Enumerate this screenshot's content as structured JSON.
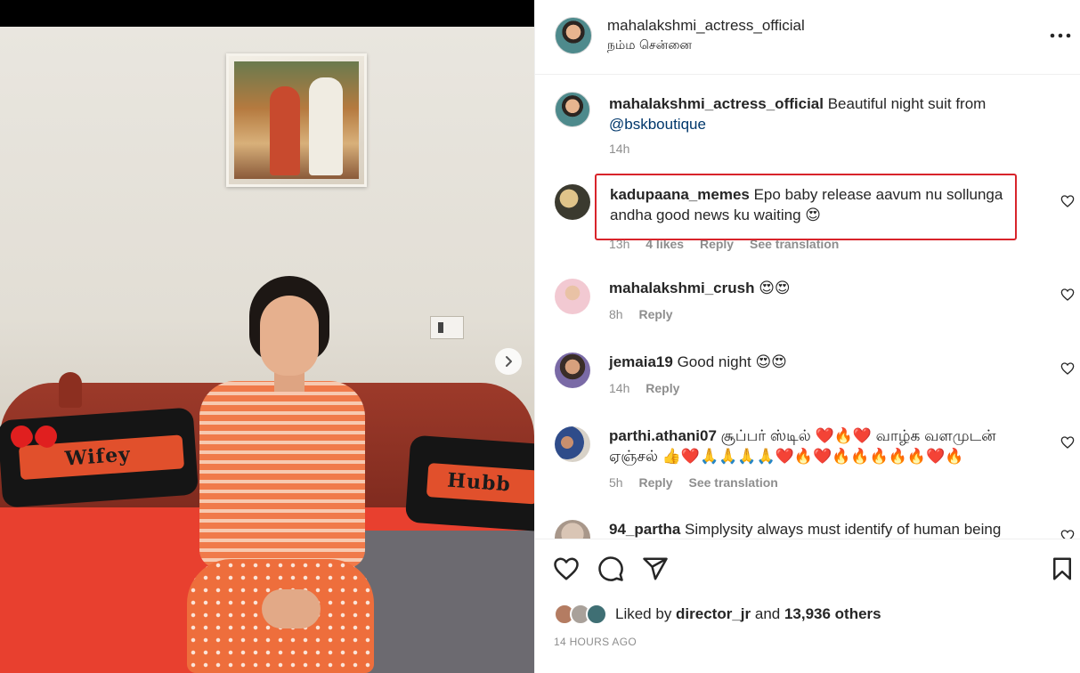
{
  "post": {
    "username": "mahalakshmi_actress_official",
    "location": "நம்ம சென்னை",
    "media": {
      "pillow_left_text": "Wifey",
      "pillow_right_text": "Hubb"
    }
  },
  "caption": {
    "username": "mahalakshmi_actress_official",
    "text": " Beautiful night suit from ",
    "mention": "@bskboutique",
    "time": "14h"
  },
  "comments": [
    {
      "username": "kadupaana_memes",
      "text": " Epo baby release aavum nu sollunga andha good news ku waiting 😍",
      "time": "13h",
      "likes": "4 likes",
      "reply": "Reply",
      "translate": "See translation"
    },
    {
      "username": "mahalakshmi_crush",
      "text": " 😍😍",
      "time": "8h",
      "reply": "Reply"
    },
    {
      "username": "jemaia19",
      "text": " Good night 😍😍",
      "time": "14h",
      "reply": "Reply"
    },
    {
      "username": "parthi.athani07",
      "text": " சூப்பர் ஸ்டில் ❤️🔥❤️ வாழ்க வளமுடன் ஏஞ்சல் 👍❤️🙏🙏🙏🙏❤️🔥❤️🔥🔥🔥🔥🔥❤️🔥",
      "time": "5h",
      "reply": "Reply",
      "translate": "See translation"
    },
    {
      "username": "94_partha",
      "text": " Simplysity always must identify of human being"
    }
  ],
  "likes": {
    "prefix": "Liked by ",
    "user": "director_jr",
    "middle": " and ",
    "count": "13,936 others"
  },
  "time_ago": "14 HOURS AGO",
  "colors": {
    "highlight_border": "#d8242b",
    "link": "#00376b",
    "muted": "#8e8e8e"
  },
  "icons": [
    "more-options-icon",
    "heart-icon",
    "comment-icon",
    "share-icon",
    "bookmark-icon",
    "chevron-right-icon"
  ]
}
